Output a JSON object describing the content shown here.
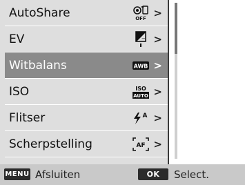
{
  "menu": {
    "items": [
      {
        "label": "AutoShare",
        "icon": "autoshare-off-icon",
        "selected": false
      },
      {
        "label": "EV",
        "icon": "exposure-compensation-icon",
        "selected": false
      },
      {
        "label": "Witbalans",
        "icon": "white-balance-awb-icon",
        "selected": true
      },
      {
        "label": "ISO",
        "icon": "iso-auto-icon",
        "selected": false
      },
      {
        "label": "Flitser",
        "icon": "flash-auto-icon",
        "selected": false
      },
      {
        "label": "Scherpstelling",
        "icon": "autofocus-icon",
        "selected": false
      }
    ],
    "arrow_glyph": ">",
    "icon_text": {
      "off": "OFF",
      "awb": "AWB",
      "iso": "ISO",
      "auto": "AUTO",
      "flash_a": "A",
      "af": "AF"
    }
  },
  "bottom": {
    "menu_badge": "MENU",
    "exit_label": "Afsluiten",
    "ok_badge": "OK",
    "select_label": "Select."
  },
  "colors": {
    "menu_bg": "#dedede",
    "selected_bg": "#8a8a8a",
    "bottom_bg": "#c9c9c9"
  }
}
